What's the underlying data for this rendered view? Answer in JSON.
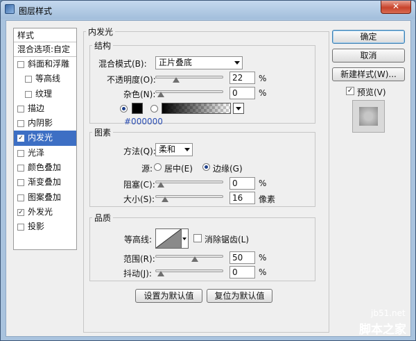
{
  "window": {
    "title": "图层样式",
    "close_label": "✕"
  },
  "styles_list": {
    "header": "样式",
    "blend_options": "混合选项:自定",
    "items": [
      {
        "label": "斜面和浮雕",
        "checked": false,
        "sub": false,
        "selected": false
      },
      {
        "label": "等高线",
        "checked": false,
        "sub": true,
        "selected": false
      },
      {
        "label": "纹理",
        "checked": false,
        "sub": true,
        "selected": false
      },
      {
        "label": "描边",
        "checked": false,
        "sub": false,
        "selected": false
      },
      {
        "label": "内阴影",
        "checked": false,
        "sub": false,
        "selected": false
      },
      {
        "label": "内发光",
        "checked": true,
        "sub": false,
        "selected": true
      },
      {
        "label": "光泽",
        "checked": false,
        "sub": false,
        "selected": false
      },
      {
        "label": "颜色叠加",
        "checked": false,
        "sub": false,
        "selected": false
      },
      {
        "label": "渐变叠加",
        "checked": false,
        "sub": false,
        "selected": false
      },
      {
        "label": "图案叠加",
        "checked": false,
        "sub": false,
        "selected": false
      },
      {
        "label": "外发光",
        "checked": true,
        "sub": false,
        "selected": false
      },
      {
        "label": "投影",
        "checked": false,
        "sub": false,
        "selected": false
      }
    ]
  },
  "inner_glow": {
    "title": "内发光",
    "structure": {
      "title": "结构",
      "blend_mode_label": "混合模式(B):",
      "blend_mode_value": "正片叠底",
      "opacity_label": "不透明度(O):",
      "opacity_value": "22",
      "opacity_level": 0.22,
      "noise_label": "杂色(N):",
      "noise_value": "0",
      "noise_level": 0,
      "percent": "%",
      "color_hex": "#000000"
    },
    "elements": {
      "title": "图素",
      "technique_label": "方法(Q):",
      "technique_value": "柔和",
      "source_label": "源:",
      "source_center": "居中(E)",
      "source_edge": "边缘(G)",
      "source_selected": "edge",
      "choke_label": "阻塞(C):",
      "choke_value": "0",
      "choke_level": 0,
      "size_label": "大小(S):",
      "size_value": "16",
      "size_level": 0.064,
      "size_unit": "像素"
    },
    "quality": {
      "title": "品质",
      "contour_label": "等高线:",
      "anti_alias_label": "消除锯齿(L)",
      "anti_alias_checked": false,
      "range_label": "范围(R):",
      "range_value": "50",
      "range_level": 0.5,
      "jitter_label": "抖动(J):",
      "jitter_value": "0",
      "jitter_level": 0
    },
    "make_default": "设置为默认值",
    "reset_default": "复位为默认值"
  },
  "buttons": {
    "ok": "确定",
    "cancel": "取消",
    "new_style": "新建样式(W)...",
    "preview_label": "预览(V)",
    "preview_checked": true
  },
  "watermark": {
    "site": "jb51.net",
    "name": "脚本之家"
  },
  "colors": {
    "selection": "#3d6fc4",
    "title_bar": "#a9c3de",
    "close": "#c8432b",
    "glow_color": "#000000"
  }
}
